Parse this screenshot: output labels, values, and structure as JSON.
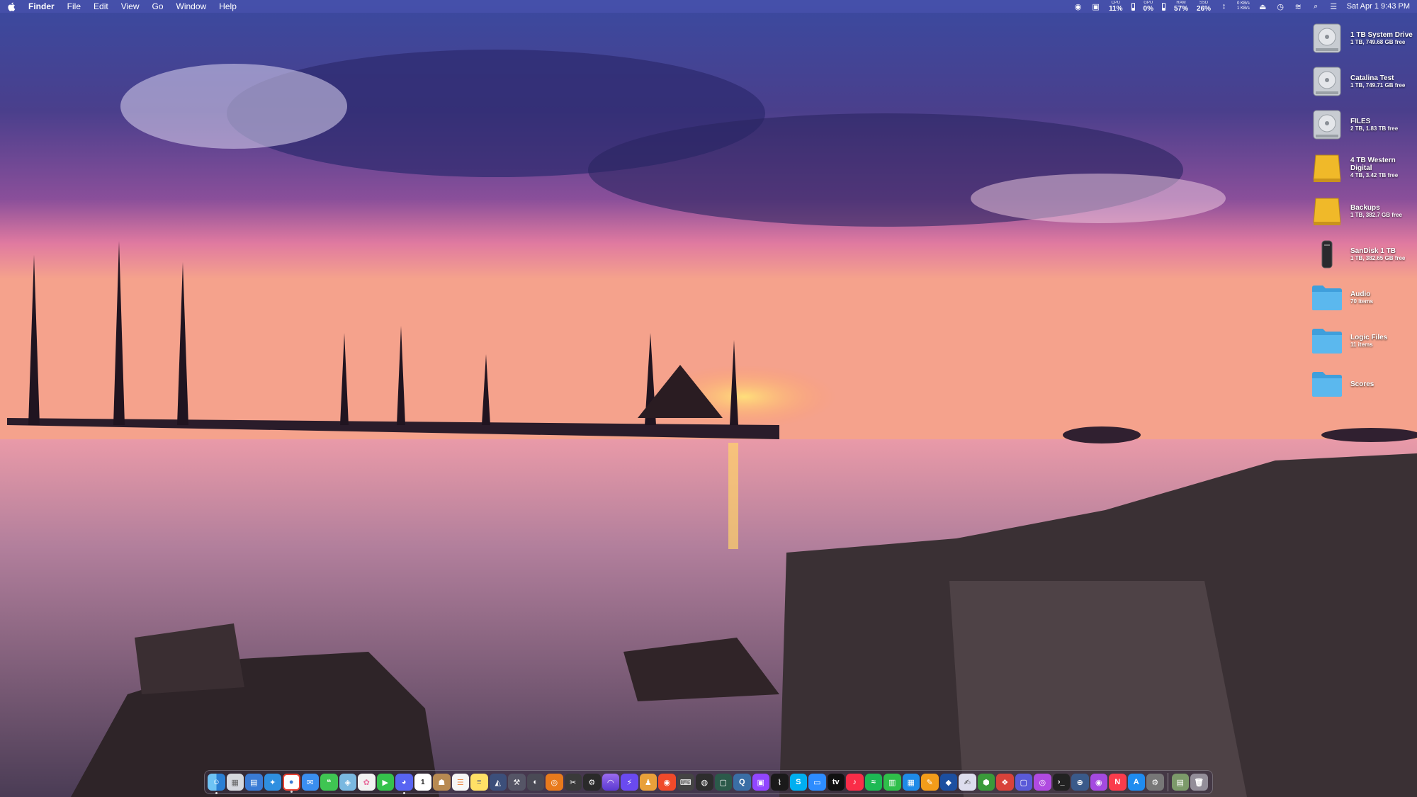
{
  "menubar": {
    "app_name": "Finder",
    "menus": [
      "File",
      "Edit",
      "View",
      "Go",
      "Window",
      "Help"
    ],
    "stats": [
      {
        "label": "CPU",
        "value": "11%"
      },
      {
        "label": "GPU",
        "value": "0%"
      },
      {
        "label": "RAM",
        "value": "57%"
      },
      {
        "label": "SSD",
        "value": "26%"
      }
    ],
    "network": {
      "up": "0 KB/s",
      "down": "1 KB/s"
    },
    "datetime": "Sat Apr 1  9:43 PM"
  },
  "desktop_items": [
    {
      "name": "1 TB System Drive",
      "info": "1 TB, 749.68 GB free",
      "icon": "internal-drive-icon"
    },
    {
      "name": "Catalina Test",
      "info": "1 TB, 749.71 GB free",
      "icon": "internal-drive-icon"
    },
    {
      "name": "FILES",
      "info": "2 TB, 1.83 TB free",
      "icon": "internal-drive-icon"
    },
    {
      "name": "4 TB Western Digital",
      "info": "4 TB, 3.42 TB free",
      "icon": "external-drive-icon"
    },
    {
      "name": "Backups",
      "info": "1 TB, 382.7 GB free",
      "icon": "external-drive-icon"
    },
    {
      "name": "SanDisk 1 TB",
      "info": "1 TB, 382.65 GB free",
      "icon": "usb-drive-icon"
    },
    {
      "name": "Audio",
      "info": "70 items",
      "icon": "folder-icon"
    },
    {
      "name": "Logic Files",
      "info": "11 items",
      "icon": "folder-icon"
    },
    {
      "name": "Scores",
      "info": "",
      "icon": "folder-icon"
    }
  ],
  "colors": {
    "menubar": "#4650aa",
    "folder": "#5bb8ee",
    "external_drive": "#f0b929",
    "internal_drive": "#c8ccd2"
  }
}
